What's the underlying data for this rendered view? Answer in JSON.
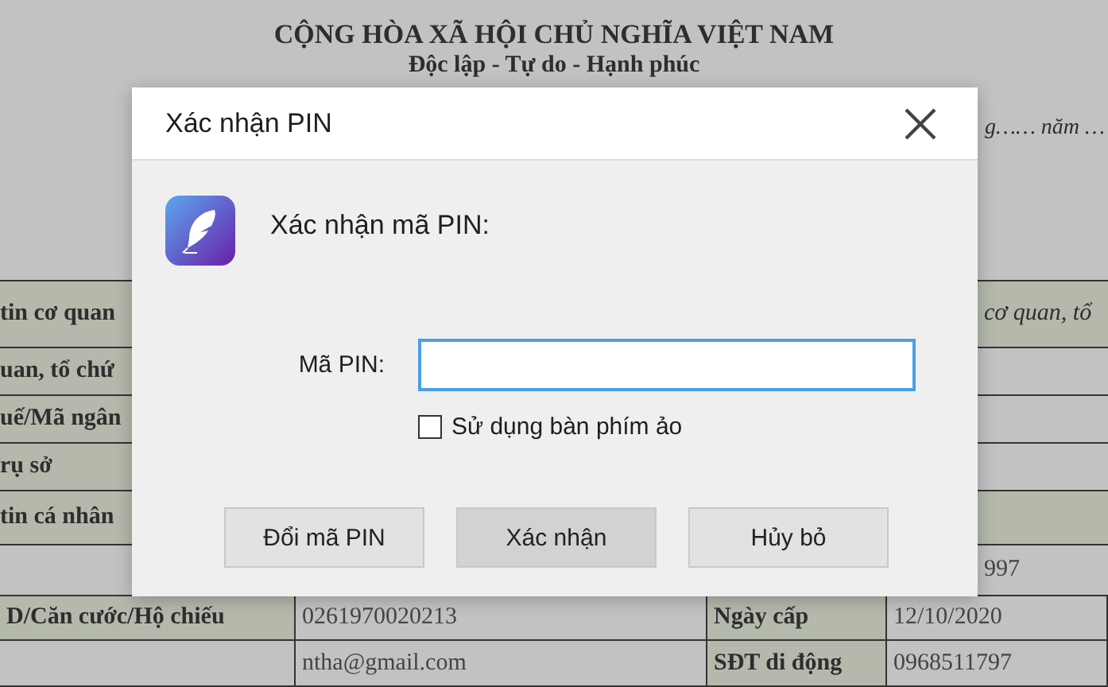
{
  "document": {
    "title": "CỘNG HÒA XÃ HỘI CHỦ NGHĨA VIỆT NAM",
    "subtitle": "Độc lập - Tự do - Hạnh phúc",
    "date_fragment": "g…… năm …",
    "rows": [
      {
        "kind": "partial",
        "cells": [
          {
            "kind": "label",
            "text": "tin cơ quan"
          },
          {
            "kind": "note",
            "text": "cơ quan, tổ"
          }
        ]
      },
      {
        "kind": "partial",
        "cells": [
          {
            "kind": "label",
            "text": "uan, tổ chứ"
          },
          {
            "kind": "empty"
          }
        ]
      },
      {
        "kind": "partial",
        "cells": [
          {
            "kind": "label",
            "text": "uế/Mã ngân"
          },
          {
            "kind": "empty"
          }
        ]
      },
      {
        "kind": "partial",
        "cells": [
          {
            "kind": "label",
            "text": "rụ sở"
          },
          {
            "kind": "empty"
          }
        ]
      },
      {
        "kind": "partial",
        "cells": [
          {
            "kind": "label",
            "text": "tin cá nhân"
          },
          {
            "kind": "note"
          }
        ]
      },
      {
        "kind": "partial",
        "cells": [
          {
            "kind": "empty"
          },
          {
            "kind": "value",
            "text": "997"
          }
        ]
      },
      {
        "kind": "full",
        "cells": [
          {
            "kind": "label",
            "text": "D/Căn cước/Hộ chiếu"
          },
          {
            "kind": "value",
            "text": "0261970020213"
          },
          {
            "kind": "label",
            "text": "Ngày cấp"
          },
          {
            "kind": "value",
            "text": "12/10/2020"
          }
        ]
      },
      {
        "kind": "full",
        "cells": [
          {
            "kind": "empty"
          },
          {
            "kind": "value",
            "text": "ntha@gmail.com"
          },
          {
            "kind": "label",
            "text": "SĐT di động"
          },
          {
            "kind": "value",
            "text": "0968511797"
          }
        ]
      }
    ]
  },
  "dialog": {
    "title": "Xác nhận PIN",
    "heading": "Xác nhận mã PIN:",
    "pin_label": "Mã PIN:",
    "focused": true,
    "virtual_keyboard": {
      "label": "Sử dụng bàn phím ảo",
      "checked": false
    },
    "buttons": [
      {
        "label": "Đổi mã PIN",
        "default": false
      },
      {
        "label": "Xác nhận",
        "default": true
      },
      {
        "label": "Hủy bỏ",
        "default": false
      }
    ]
  }
}
